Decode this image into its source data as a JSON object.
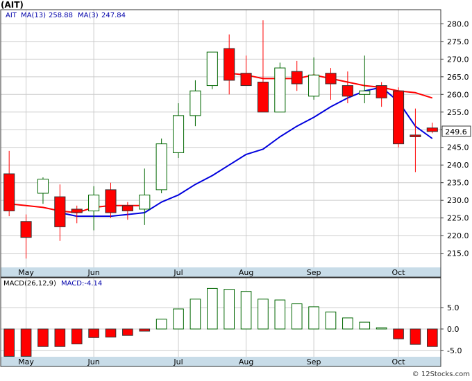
{
  "title": "(AIT)",
  "legend": {
    "symbol": "AIT",
    "ma13_label": "MA(13)",
    "ma13_value": "258.88",
    "ma3_label": "MA(3)",
    "ma3_value": "247.84",
    "macd_label": "MACD(26,12,9)",
    "macd_value_label": "MACD:-4.14"
  },
  "price_tag": "249.6",
  "watermark": "© 12Stocks.com",
  "colors": {
    "up": "#006600",
    "down": "#ff0000",
    "ma13": "#ff0000",
    "ma3": "#0000dd",
    "band": "#c8dce8",
    "grid": "#cccccc"
  },
  "chart_data": [
    {
      "type": "candlestick",
      "title": "(AIT)",
      "ylim": [
        211,
        284
      ],
      "y_ticks": [
        215,
        220,
        225,
        230,
        235,
        240,
        245,
        250,
        255,
        260,
        265,
        270,
        275,
        280
      ],
      "x_labels": [
        {
          "label": "May",
          "index": 1
        },
        {
          "label": "Jun",
          "index": 5
        },
        {
          "label": "Jul",
          "index": 10
        },
        {
          "label": "Aug",
          "index": 14
        },
        {
          "label": "Sep",
          "index": 18
        },
        {
          "label": "Oct",
          "index": 23
        }
      ],
      "candles": [
        {
          "o": 237.5,
          "h": 244,
          "l": 225.5,
          "c": 227
        },
        {
          "o": 224,
          "h": 226,
          "l": 213.5,
          "c": 219.5
        },
        {
          "o": 232,
          "h": 236.5,
          "l": 229,
          "c": 236
        },
        {
          "o": 231,
          "h": 234.5,
          "l": 218.5,
          "c": 222.5
        },
        {
          "o": 227.5,
          "h": 228.5,
          "l": 223.5,
          "c": 226.5
        },
        {
          "o": 227,
          "h": 234,
          "l": 221.5,
          "c": 231.5
        },
        {
          "o": 233,
          "h": 235,
          "l": 225,
          "c": 226.5
        },
        {
          "o": 228.5,
          "h": 229.5,
          "l": 224.5,
          "c": 227
        },
        {
          "o": 227.5,
          "h": 239,
          "l": 223,
          "c": 231.5
        },
        {
          "o": 233,
          "h": 247.5,
          "l": 232,
          "c": 246
        },
        {
          "o": 243.5,
          "h": 257.5,
          "l": 242,
          "c": 254
        },
        {
          "o": 254,
          "h": 264,
          "l": 251,
          "c": 261
        },
        {
          "o": 262.5,
          "h": 272,
          "l": 261.5,
          "c": 272
        },
        {
          "o": 273,
          "h": 277,
          "l": 260,
          "c": 264
        },
        {
          "o": 266,
          "h": 271,
          "l": 262.5,
          "c": 262.5
        },
        {
          "o": 263.5,
          "h": 281,
          "l": 255,
          "c": 255
        },
        {
          "o": 255,
          "h": 269,
          "l": 255,
          "c": 267.5
        },
        {
          "o": 266.5,
          "h": 269.5,
          "l": 261,
          "c": 263
        },
        {
          "o": 259.5,
          "h": 270.5,
          "l": 258.5,
          "c": 265.5
        },
        {
          "o": 266,
          "h": 267.5,
          "l": 258.5,
          "c": 263
        },
        {
          "o": 262.5,
          "h": 266.5,
          "l": 257.5,
          "c": 259.5
        },
        {
          "o": 260,
          "h": 271,
          "l": 257.5,
          "c": 261
        },
        {
          "o": 262.5,
          "h": 263.5,
          "l": 256.5,
          "c": 259
        },
        {
          "o": 261,
          "h": 262,
          "l": 245,
          "c": 246
        },
        {
          "o": 248.5,
          "h": 256,
          "l": 238,
          "c": 248
        },
        {
          "o": 250.5,
          "h": 252,
          "l": 249,
          "c": 249.5
        }
      ],
      "ma13": [
        229,
        228.5,
        228,
        227,
        226.5,
        228,
        228.5,
        228.5,
        228.5,
        null,
        null,
        null,
        null,
        266,
        265.5,
        264.5,
        264.5,
        264.5,
        265.5,
        264.5,
        263.5,
        262.5,
        262,
        261,
        260.5,
        259
      ],
      "ma3": [
        null,
        null,
        null,
        226.5,
        225.5,
        225.5,
        225.5,
        226,
        226.5,
        229.5,
        231.5,
        234.5,
        237,
        240,
        243,
        244.5,
        248,
        251,
        253.5,
        256.5,
        259,
        261,
        262,
        258,
        251,
        247.5
      ]
    },
    {
      "type": "bar",
      "title": "MACD(26,12,9)",
      "ylim": [
        -6.5,
        12
      ],
      "y_ticks": [
        -5,
        0,
        5
      ],
      "values": [
        -6.4,
        -6.4,
        -4.1,
        -4.1,
        -3.5,
        -2,
        -1.9,
        -1.5,
        -0.5,
        2.3,
        4.7,
        7,
        9.5,
        9.3,
        8.8,
        7,
        6.8,
        5.9,
        5.2,
        4,
        2.6,
        1.6,
        0.3,
        -2.3,
        -3.6,
        -4.1
      ]
    }
  ]
}
